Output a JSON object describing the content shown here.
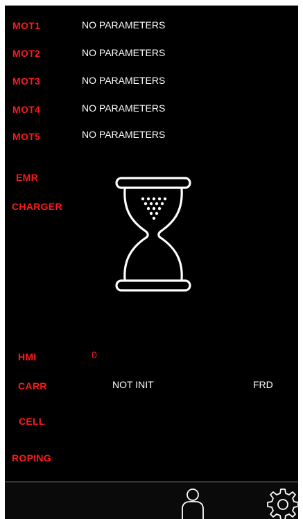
{
  "motors": [
    {
      "label": "MOT1",
      "status": "NO PARAMETERS"
    },
    {
      "label": "MOT2",
      "status": "NO PARAMETERS"
    },
    {
      "label": "MOT3",
      "status": "NO PARAMETERS"
    },
    {
      "label": "MOT4",
      "status": "NO PARAMETERS"
    },
    {
      "label": "MOT5",
      "status": "NO PARAMETERS"
    }
  ],
  "emr": {
    "label": "EMR"
  },
  "charger": {
    "label": "CHARGER"
  },
  "loading": {
    "icon": "hourglass-icon"
  },
  "hmi": {
    "label": "HMI",
    "value": "0"
  },
  "carr": {
    "label": "CARR",
    "status": "NOT INIT",
    "mode": "FRD"
  },
  "cell": {
    "label": "CELL"
  },
  "roping": {
    "label": "ROPING"
  },
  "footer": {
    "icons": [
      "user-icon",
      "settings-gear-icon"
    ]
  },
  "colors": {
    "background": "#000000",
    "label": "#ff1a1a",
    "text": "#ffffff",
    "divider": "#8c8c8c"
  }
}
